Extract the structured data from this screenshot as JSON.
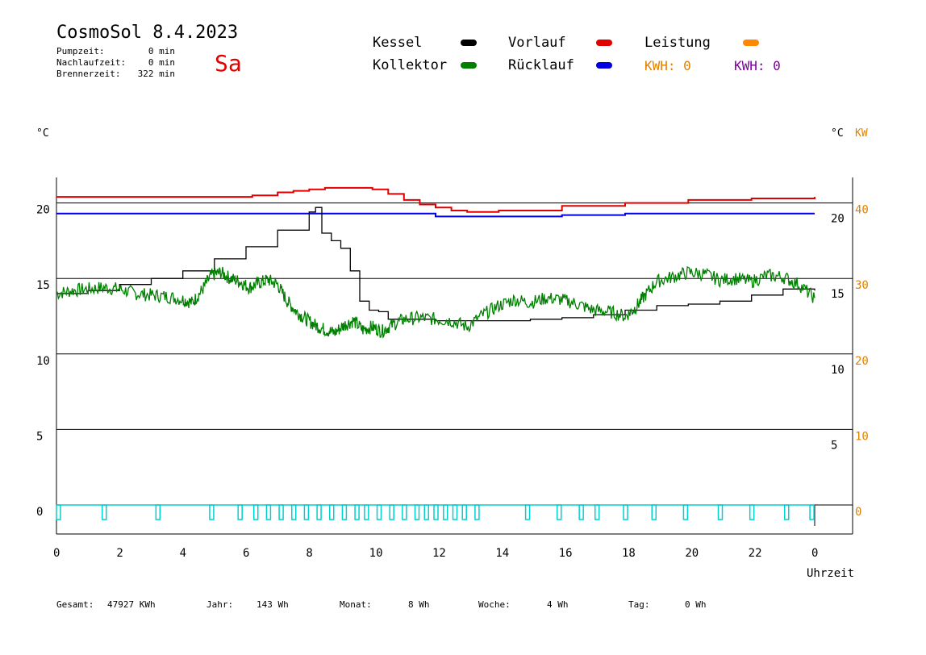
{
  "header": {
    "title": "CosmoSol 8.4.2023",
    "day": "Sa",
    "stats": [
      {
        "label": "Pumpzeit:",
        "value": "0 min"
      },
      {
        "label": "Nachlaufzeit:",
        "value": "0 min"
      },
      {
        "label": "Brennerzeit:",
        "value": "322 min"
      }
    ]
  },
  "legend": {
    "items": [
      {
        "label": "Kessel",
        "color": "#000000"
      },
      {
        "label": "Vorlauf",
        "color": "#e00000"
      },
      {
        "label": "Leistung",
        "color": "#ff8800"
      },
      {
        "label": "Kollektor",
        "color": "#008000"
      },
      {
        "label": "Rücklauf",
        "color": "#0000e0"
      }
    ],
    "kwh1": "KWH: 0",
    "kwh1_color": "#e08000",
    "kwh2": "KWH: 0",
    "kwh2_color": "#8000a0"
  },
  "axis_units": {
    "left": "°C",
    "right_c": "°C",
    "right_kw": "KW"
  },
  "footer": {
    "gesamt_label": "Gesamt:",
    "gesamt_value": "47927 KWh",
    "jahr_label": "Jahr:",
    "jahr_value": "143 Wh",
    "monat_label": "Monat:",
    "monat_value": "8 Wh",
    "woche_label": "Woche:",
    "woche_value": "4 Wh",
    "tag_label": "Tag:",
    "tag_value": "0 Wh"
  },
  "chart_data": {
    "type": "line",
    "title": "CosmoSol 8.4.2023",
    "xlabel": "Uhrzeit",
    "ylabel": "°C",
    "xlim": [
      0,
      24
    ],
    "ylim": [
      0,
      22
    ],
    "x_ticks": [
      "0",
      "2",
      "4",
      "6",
      "8",
      "10",
      "12",
      "14",
      "16",
      "18",
      "20",
      "22",
      "0"
    ],
    "y_ticks_left": [
      "0",
      "5",
      "10",
      "15",
      "20"
    ],
    "y_ticks_right_c": [
      "5",
      "10",
      "15",
      "20"
    ],
    "y_ticks_right_kw": [
      "0",
      "10",
      "20",
      "30",
      "40"
    ],
    "grid": true,
    "series": [
      {
        "name": "Vorlauf",
        "color": "#e00000",
        "x": [
          0,
          6,
          6.2,
          7,
          7.5,
          8,
          8.5,
          9,
          9.5,
          10,
          10.5,
          11,
          11.5,
          12,
          12.5,
          13,
          14,
          16,
          18,
          20,
          22,
          24
        ],
        "y": [
          20.4,
          20.4,
          20.5,
          20.7,
          20.8,
          20.9,
          21.0,
          21.0,
          21.0,
          20.9,
          20.6,
          20.2,
          19.9,
          19.7,
          19.5,
          19.4,
          19.5,
          19.8,
          20.0,
          20.2,
          20.3,
          20.4
        ]
      },
      {
        "name": "Rücklauf",
        "color": "#0000e0",
        "x": [
          0,
          8,
          10,
          12,
          14,
          16,
          18,
          20,
          22,
          24
        ],
        "y": [
          19.3,
          19.3,
          19.3,
          19.1,
          19.1,
          19.2,
          19.3,
          19.3,
          19.3,
          19.3
        ]
      },
      {
        "name": "Kessel",
        "color": "#000000",
        "x": [
          0,
          1,
          2,
          3,
          4,
          5,
          6,
          7,
          8,
          8.2,
          8.4,
          8.7,
          9,
          9.3,
          9.6,
          9.9,
          10.2,
          10.5,
          11,
          12,
          13,
          14,
          15,
          16,
          17,
          18,
          19,
          20,
          21,
          22,
          23,
          24
        ],
        "y": [
          14.0,
          14.2,
          14.6,
          15.0,
          15.5,
          16.3,
          17.1,
          18.2,
          19.4,
          19.7,
          18.0,
          17.5,
          17.0,
          15.5,
          13.5,
          12.9,
          12.8,
          12.3,
          12.3,
          12.2,
          12.2,
          12.2,
          12.3,
          12.4,
          12.6,
          12.9,
          13.2,
          13.3,
          13.5,
          13.9,
          14.3,
          14.2
        ]
      },
      {
        "name": "Kollektor",
        "color": "#008000",
        "x": [
          0,
          0.5,
          1,
          1.5,
          2,
          2.5,
          3,
          3.5,
          4,
          4.3,
          4.6,
          4.9,
          5.2,
          5.5,
          5.8,
          6.1,
          6.4,
          6.7,
          7,
          7.3,
          7.6,
          7.9,
          8.2,
          8.5,
          8.8,
          9.1,
          9.4,
          9.7,
          10,
          10.3,
          10.6,
          11,
          11.5,
          12,
          12.5,
          13,
          13.5,
          14,
          14.5,
          15,
          15.5,
          16,
          16.5,
          17,
          17.5,
          18,
          18.3,
          18.6,
          19,
          19.5,
          20,
          20.5,
          21,
          21.5,
          22,
          22.5,
          23,
          23.5,
          24
        ],
        "y": [
          14.0,
          14.2,
          14.3,
          14.4,
          14.3,
          14.0,
          13.9,
          13.8,
          13.6,
          13.4,
          14.2,
          15.2,
          15.4,
          15.0,
          14.8,
          14.4,
          14.7,
          14.9,
          14.6,
          13.5,
          12.8,
          12.3,
          11.9,
          11.6,
          11.4,
          11.9,
          12.2,
          11.6,
          11.8,
          11.5,
          11.9,
          12.3,
          12.4,
          12.3,
          12.2,
          11.8,
          12.6,
          13.2,
          13.6,
          13.4,
          13.7,
          13.6,
          13.3,
          12.9,
          12.8,
          12.5,
          13.0,
          13.8,
          14.8,
          15.1,
          15.4,
          15.3,
          14.9,
          15.0,
          14.8,
          15.2,
          15.1,
          14.6,
          13.7
        ]
      },
      {
        "name": "Leistung",
        "color": "#ff8800",
        "x": [
          0,
          24
        ],
        "y": [
          0,
          0
        ]
      }
    ],
    "pump_pulses_hours": [
      0.05,
      1.5,
      3.2,
      4.9,
      5.8,
      6.3,
      6.7,
      7.1,
      7.5,
      7.9,
      8.3,
      8.7,
      9.1,
      9.5,
      9.8,
      10.2,
      10.6,
      11.0,
      11.4,
      11.7,
      12.0,
      12.3,
      12.6,
      12.9,
      13.3,
      14.9,
      15.9,
      16.6,
      17.1,
      18.0,
      18.9,
      19.9,
      21.0,
      22.0,
      23.1,
      23.9
    ]
  }
}
